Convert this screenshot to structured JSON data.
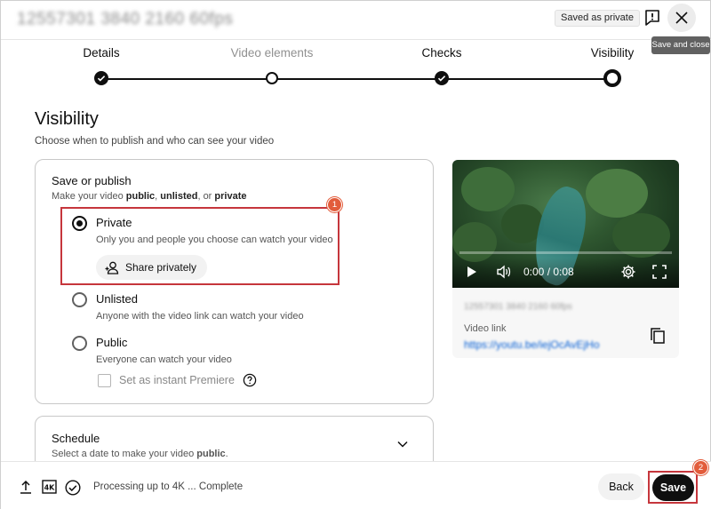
{
  "header": {
    "video_title": "12557301 3840 2160 60fps",
    "saved_badge": "Saved as private",
    "close_tooltip": "Save and close"
  },
  "stepper": {
    "steps": [
      {
        "label": "Details",
        "state": "done"
      },
      {
        "label": "Video elements",
        "state": "open"
      },
      {
        "label": "Checks",
        "state": "done"
      },
      {
        "label": "Visibility",
        "state": "current"
      }
    ]
  },
  "visibility": {
    "title": "Visibility",
    "subtitle": "Choose when to publish and who can see your video",
    "save_publish": {
      "title": "Save or publish",
      "desc_prefix": "Make your video ",
      "desc_public": "public",
      "desc_sep1": ", ",
      "desc_unlisted": "unlisted",
      "desc_sep2": ", or ",
      "desc_private": "private",
      "options": [
        {
          "label": "Private",
          "desc": "Only you and people you choose can watch your video",
          "selected": true
        },
        {
          "label": "Unlisted",
          "desc": "Anyone with the video link can watch your video",
          "selected": false
        },
        {
          "label": "Public",
          "desc": "Everyone can watch your video",
          "selected": false
        }
      ],
      "share_button": "Share privately",
      "premiere_label": "Set as instant Premiere"
    },
    "schedule": {
      "title": "Schedule",
      "desc_prefix": "Select a date to make your video ",
      "desc_bold": "public",
      "desc_suffix": "."
    }
  },
  "preview": {
    "time": "0:00 / 0:08",
    "filename": "12557301 3840 2160 60fps",
    "link_label": "Video link",
    "link_url": "https://youtu.be/iejOcAvEjHo"
  },
  "footer": {
    "status": "Processing up to 4K ... Complete",
    "back_label": "Back",
    "save_label": "Save"
  },
  "markers": {
    "one": "1",
    "two": "2"
  },
  "colors": {
    "accent_dark": "#0f0f0f",
    "highlight_red": "#c6363c",
    "marker_orange": "#e25c3b",
    "link_blue": "#065fd4"
  }
}
